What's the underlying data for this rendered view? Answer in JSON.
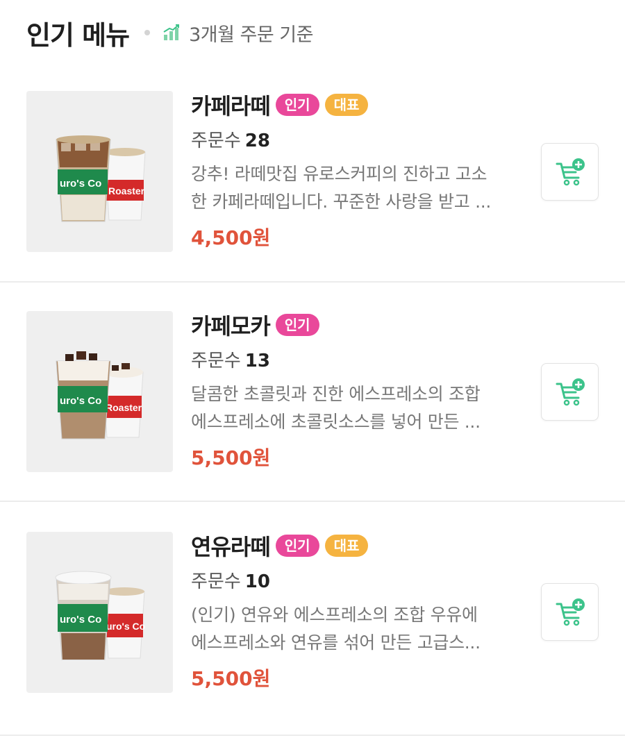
{
  "header": {
    "title": "인기 메뉴",
    "subtitle": "3개월 주문 기준",
    "icon": "bar-chart-icon"
  },
  "colors": {
    "badge_popular": "#e9489a",
    "badge_signature": "#f5b340",
    "price": "#e0533b",
    "cart_accent": "#3cc38b"
  },
  "menu_items": [
    {
      "name": "카페라떼",
      "badges": [
        "인기",
        "대표"
      ],
      "orders_label": "주문수",
      "orders_count": "28",
      "desc_line1": "강추! 라떼맛집 유로스커피의 진하고 고소",
      "desc_line2": "한 카페라떼입니다. 꾸준한 사랑을 받고 ...",
      "price": "4,500원",
      "cup_text_1": "uro's Co",
      "cup_text_2": "Roaster"
    },
    {
      "name": "카페모카",
      "badges": [
        "인기"
      ],
      "orders_label": "주문수",
      "orders_count": "13",
      "desc_line1": "달콤한 초콜릿과 진한 에스프레소의 조합",
      "desc_line2": "에스프레소에 초콜릿소스를 넣어 만든 ...",
      "price": "5,500원",
      "cup_text_1": "uro's Co",
      "cup_text_2": "Roaster"
    },
    {
      "name": "연유라떼",
      "badges": [
        "인기",
        "대표"
      ],
      "orders_label": "주문수",
      "orders_count": "10",
      "desc_line1": "(인기) 연유와 에스프레소의 조합 우유에",
      "desc_line2": "에스프레소와 연유를 섞어 만든 고급스...",
      "price": "5,500원",
      "cup_text_1": "uro's Co",
      "cup_text_2": "uro's Co"
    }
  ]
}
